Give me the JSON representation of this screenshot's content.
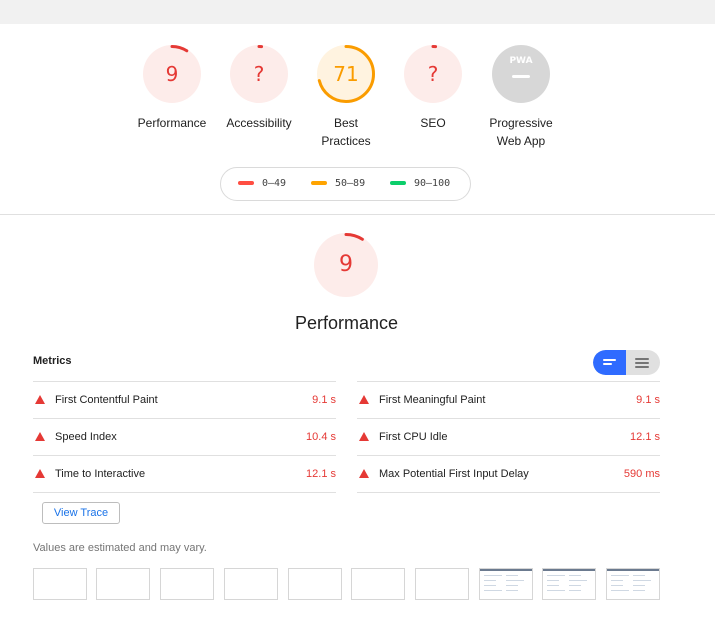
{
  "gauges": [
    {
      "score": "9",
      "label_lines": [
        "Performance"
      ],
      "color": "#e53935",
      "bg": "#fdecea",
      "fraction": 0.09
    },
    {
      "score": "?",
      "label_lines": [
        "Accessibility"
      ],
      "color": "#e53935",
      "bg": "#fdecea",
      "fraction": 0.0
    },
    {
      "score": "71",
      "label_lines": [
        "Best",
        "Practices"
      ],
      "color": "#fa9c00",
      "bg": "#fff3e0",
      "fraction": 0.71
    },
    {
      "score": "?",
      "label_lines": [
        "SEO"
      ],
      "color": "#e53935",
      "bg": "#fdecea",
      "fraction": 0.0
    },
    {
      "score": "PWA",
      "label_lines": [
        "Progressive",
        "Web App"
      ],
      "color": "#9e9e9e",
      "bg": "#d7d7d7",
      "fraction": 0.0,
      "icon": "pwa-badge-icon"
    }
  ],
  "legend": [
    {
      "range": "0–49",
      "color": "#ff4e42"
    },
    {
      "range": "50–89",
      "color": "#ffa400"
    },
    {
      "range": "90–100",
      "color": "#0cce6b"
    }
  ],
  "category": {
    "score": "9",
    "fraction": 0.09,
    "title": "Performance",
    "color": "#e53935",
    "bg": "#fdecea"
  },
  "metrics": {
    "heading": "Metrics",
    "toggle_icons": [
      "lines-expanded-icon",
      "lines-compact-icon"
    ],
    "left": [
      {
        "name": "First Contentful Paint",
        "value": "9.1 s"
      },
      {
        "name": "Speed Index",
        "value": "10.4 s"
      },
      {
        "name": "Time to Interactive",
        "value": "12.1 s"
      }
    ],
    "right": [
      {
        "name": "First Meaningful Paint",
        "value": "9.1 s"
      },
      {
        "name": "First CPU Idle",
        "value": "12.1 s"
      },
      {
        "name": "Max Potential First Input Delay",
        "value": "590 ms"
      }
    ],
    "fail_icon": "fail-triangle-icon",
    "fail_color": "#e53935"
  },
  "view_trace_label": "View Trace",
  "note": "Values are estimated and may vary.",
  "filmstrip": {
    "frames": [
      {
        "content": false
      },
      {
        "content": false
      },
      {
        "content": false
      },
      {
        "content": false
      },
      {
        "content": false
      },
      {
        "content": false
      },
      {
        "content": false
      },
      {
        "content": true
      },
      {
        "content": true
      },
      {
        "content": true
      }
    ]
  }
}
